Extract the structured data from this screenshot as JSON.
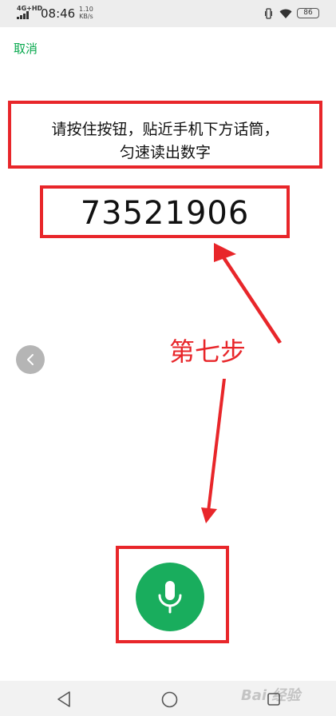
{
  "status_bar": {
    "network": "4G+HD",
    "time": "08:46",
    "speed_value": "1.10",
    "speed_unit": "KB/s",
    "battery": "86"
  },
  "cancel_label": "取消",
  "instruction": {
    "line1": "请按住按钮，贴近手机下方话筒，",
    "line2": "匀速读出数字"
  },
  "verification_code": "73521906",
  "annotation": {
    "step_label": "第七步"
  },
  "watermark": "Bai 经验",
  "colors": {
    "accent_green": "#07a84d",
    "mic_green": "#19ad5d",
    "annotation_red": "#e8262a"
  }
}
